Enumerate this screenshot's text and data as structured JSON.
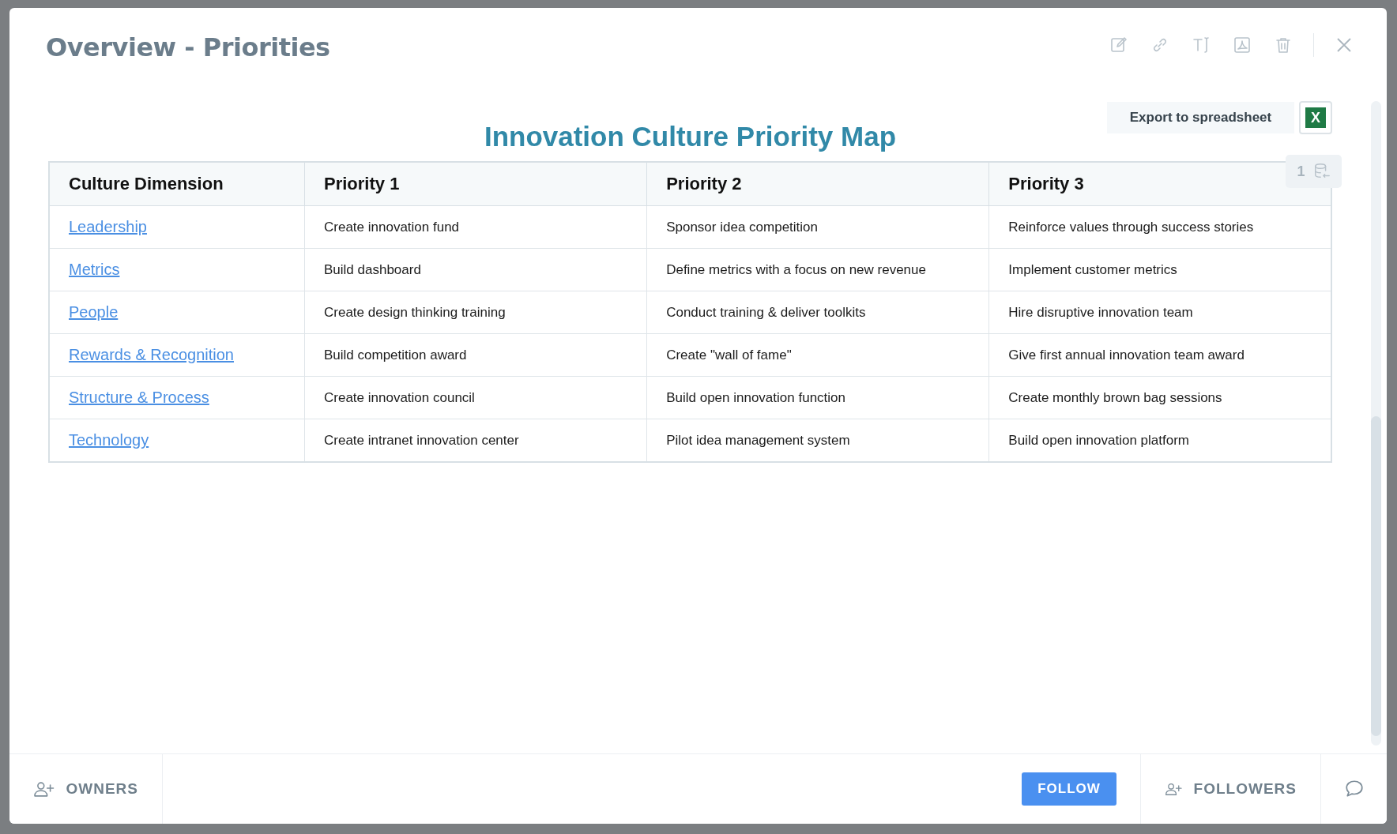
{
  "dialog": {
    "title": "Overview - Priorities",
    "toolbar": [
      {
        "kind": "edit"
      },
      {
        "kind": "link"
      },
      {
        "kind": "text"
      },
      {
        "kind": "pdf"
      },
      {
        "kind": "delete"
      }
    ]
  },
  "map": {
    "title": "Innovation Culture Priority Map",
    "export_label": "Export to spreadsheet",
    "export_icon": "X",
    "record_count": "1",
    "columns": [
      "Culture Dimension",
      "Priority 1",
      "Priority 2",
      "Priority 3"
    ],
    "rows": [
      {
        "dimension": "Leadership",
        "priorities": [
          "Create innovation fund",
          "Sponsor idea competition",
          "Reinforce values through success stories"
        ]
      },
      {
        "dimension": "Metrics",
        "priorities": [
          "Build dashboard",
          "Define metrics with a focus on new revenue",
          "Implement customer metrics"
        ]
      },
      {
        "dimension": "People",
        "priorities": [
          "Create design thinking training",
          "Conduct training & deliver toolkits",
          "Hire disruptive innovation team"
        ]
      },
      {
        "dimension": "Rewards & Recognition",
        "priorities": [
          "Build competition award",
          "Create \"wall of fame\"",
          "Give first annual innovation team award"
        ]
      },
      {
        "dimension": "Structure & Process",
        "priorities": [
          "Create innovation council",
          "Build open innovation function",
          "Create monthly brown bag sessions"
        ]
      },
      {
        "dimension": "Technology",
        "priorities": [
          "Create intranet innovation center",
          "Pilot idea management system",
          "Build open innovation platform"
        ]
      }
    ]
  },
  "footer": {
    "owners": "OWNERS",
    "follow": "FOLLOW",
    "followers": "FOLLOWERS"
  }
}
